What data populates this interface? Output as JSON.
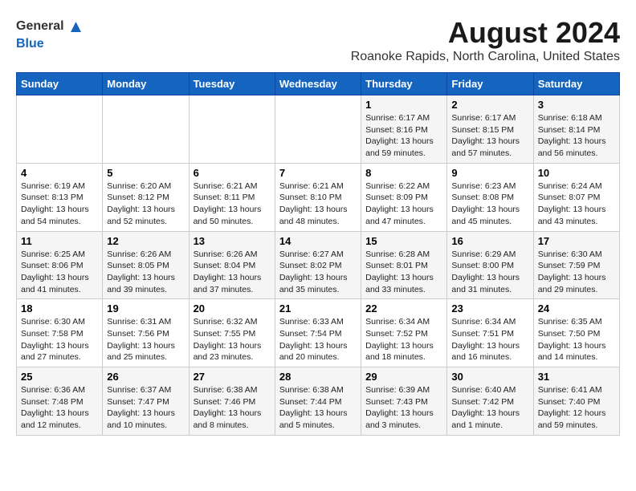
{
  "header": {
    "logo_general": "General",
    "logo_blue": "Blue",
    "main_title": "August 2024",
    "subtitle": "Roanoke Rapids, North Carolina, United States"
  },
  "calendar": {
    "days_of_week": [
      "Sunday",
      "Monday",
      "Tuesday",
      "Wednesday",
      "Thursday",
      "Friday",
      "Saturday"
    ],
    "weeks": [
      [
        {
          "day": "",
          "info": ""
        },
        {
          "day": "",
          "info": ""
        },
        {
          "day": "",
          "info": ""
        },
        {
          "day": "",
          "info": ""
        },
        {
          "day": "1",
          "info": "Sunrise: 6:17 AM\nSunset: 8:16 PM\nDaylight: 13 hours\nand 59 minutes."
        },
        {
          "day": "2",
          "info": "Sunrise: 6:17 AM\nSunset: 8:15 PM\nDaylight: 13 hours\nand 57 minutes."
        },
        {
          "day": "3",
          "info": "Sunrise: 6:18 AM\nSunset: 8:14 PM\nDaylight: 13 hours\nand 56 minutes."
        }
      ],
      [
        {
          "day": "4",
          "info": "Sunrise: 6:19 AM\nSunset: 8:13 PM\nDaylight: 13 hours\nand 54 minutes."
        },
        {
          "day": "5",
          "info": "Sunrise: 6:20 AM\nSunset: 8:12 PM\nDaylight: 13 hours\nand 52 minutes."
        },
        {
          "day": "6",
          "info": "Sunrise: 6:21 AM\nSunset: 8:11 PM\nDaylight: 13 hours\nand 50 minutes."
        },
        {
          "day": "7",
          "info": "Sunrise: 6:21 AM\nSunset: 8:10 PM\nDaylight: 13 hours\nand 48 minutes."
        },
        {
          "day": "8",
          "info": "Sunrise: 6:22 AM\nSunset: 8:09 PM\nDaylight: 13 hours\nand 47 minutes."
        },
        {
          "day": "9",
          "info": "Sunrise: 6:23 AM\nSunset: 8:08 PM\nDaylight: 13 hours\nand 45 minutes."
        },
        {
          "day": "10",
          "info": "Sunrise: 6:24 AM\nSunset: 8:07 PM\nDaylight: 13 hours\nand 43 minutes."
        }
      ],
      [
        {
          "day": "11",
          "info": "Sunrise: 6:25 AM\nSunset: 8:06 PM\nDaylight: 13 hours\nand 41 minutes."
        },
        {
          "day": "12",
          "info": "Sunrise: 6:26 AM\nSunset: 8:05 PM\nDaylight: 13 hours\nand 39 minutes."
        },
        {
          "day": "13",
          "info": "Sunrise: 6:26 AM\nSunset: 8:04 PM\nDaylight: 13 hours\nand 37 minutes."
        },
        {
          "day": "14",
          "info": "Sunrise: 6:27 AM\nSunset: 8:02 PM\nDaylight: 13 hours\nand 35 minutes."
        },
        {
          "day": "15",
          "info": "Sunrise: 6:28 AM\nSunset: 8:01 PM\nDaylight: 13 hours\nand 33 minutes."
        },
        {
          "day": "16",
          "info": "Sunrise: 6:29 AM\nSunset: 8:00 PM\nDaylight: 13 hours\nand 31 minutes."
        },
        {
          "day": "17",
          "info": "Sunrise: 6:30 AM\nSunset: 7:59 PM\nDaylight: 13 hours\nand 29 minutes."
        }
      ],
      [
        {
          "day": "18",
          "info": "Sunrise: 6:30 AM\nSunset: 7:58 PM\nDaylight: 13 hours\nand 27 minutes."
        },
        {
          "day": "19",
          "info": "Sunrise: 6:31 AM\nSunset: 7:56 PM\nDaylight: 13 hours\nand 25 minutes."
        },
        {
          "day": "20",
          "info": "Sunrise: 6:32 AM\nSunset: 7:55 PM\nDaylight: 13 hours\nand 23 minutes."
        },
        {
          "day": "21",
          "info": "Sunrise: 6:33 AM\nSunset: 7:54 PM\nDaylight: 13 hours\nand 20 minutes."
        },
        {
          "day": "22",
          "info": "Sunrise: 6:34 AM\nSunset: 7:52 PM\nDaylight: 13 hours\nand 18 minutes."
        },
        {
          "day": "23",
          "info": "Sunrise: 6:34 AM\nSunset: 7:51 PM\nDaylight: 13 hours\nand 16 minutes."
        },
        {
          "day": "24",
          "info": "Sunrise: 6:35 AM\nSunset: 7:50 PM\nDaylight: 13 hours\nand 14 minutes."
        }
      ],
      [
        {
          "day": "25",
          "info": "Sunrise: 6:36 AM\nSunset: 7:48 PM\nDaylight: 13 hours\nand 12 minutes."
        },
        {
          "day": "26",
          "info": "Sunrise: 6:37 AM\nSunset: 7:47 PM\nDaylight: 13 hours\nand 10 minutes."
        },
        {
          "day": "27",
          "info": "Sunrise: 6:38 AM\nSunset: 7:46 PM\nDaylight: 13 hours\nand 8 minutes."
        },
        {
          "day": "28",
          "info": "Sunrise: 6:38 AM\nSunset: 7:44 PM\nDaylight: 13 hours\nand 5 minutes."
        },
        {
          "day": "29",
          "info": "Sunrise: 6:39 AM\nSunset: 7:43 PM\nDaylight: 13 hours\nand 3 minutes."
        },
        {
          "day": "30",
          "info": "Sunrise: 6:40 AM\nSunset: 7:42 PM\nDaylight: 13 hours\nand 1 minute."
        },
        {
          "day": "31",
          "info": "Sunrise: 6:41 AM\nSunset: 7:40 PM\nDaylight: 12 hours\nand 59 minutes."
        }
      ]
    ]
  }
}
